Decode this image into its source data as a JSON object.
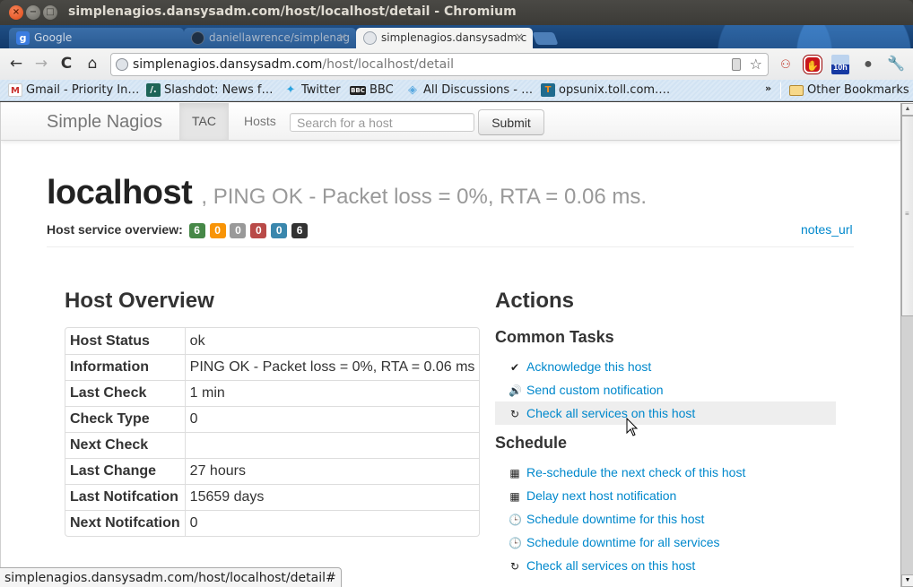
{
  "window": {
    "title": "simplenagios.dansysadm.com/host/localhost/detail - Chromium"
  },
  "tabs": [
    {
      "label": "Google",
      "icon": "google-g-icon",
      "active": false
    },
    {
      "label": "daniellawrence/simplenag",
      "icon": "github-icon",
      "active": false
    },
    {
      "label": "simplenagios.dansysadm.c",
      "icon": "globe-icon",
      "active": true
    }
  ],
  "toolbar": {
    "url_host": "simplenagios.dansysadm.com",
    "url_path": "/host/localhost/detail",
    "back_glyph": "←",
    "forward_glyph": "→",
    "reload_glyph": "C",
    "home_glyph": "🏠",
    "star_glyph": "☆",
    "extensions": [
      {
        "name": "graph-extension-icon",
        "glyph": "♙"
      },
      {
        "name": "adblock-icon",
        "glyph": "✋"
      },
      {
        "name": "timer-extension-icon",
        "glyph": "10h"
      },
      {
        "name": "droplet-icon",
        "glyph": "💧"
      },
      {
        "name": "wrench-icon",
        "glyph": "🔧"
      }
    ]
  },
  "bookmarks": [
    {
      "label": "Gmail - Priority In…",
      "icon_glyph": "M"
    },
    {
      "label": "Slashdot: News f…",
      "icon_glyph": "/."
    },
    {
      "label": "Twitter",
      "icon_glyph": "🐦"
    },
    {
      "label": "BBC",
      "icon_glyph": "BBC"
    },
    {
      "label": "All Discussions - …",
      "icon_glyph": "◈"
    },
    {
      "label": "opsunix.toll.com.…",
      "icon_glyph": "T"
    },
    {
      "label": "Other Bookmarks",
      "icon_glyph": ""
    }
  ],
  "bookmarks_more": "»",
  "nav": {
    "brand": "Simple Nagios",
    "items": [
      {
        "label": "TAC",
        "active": true
      },
      {
        "label": "Hosts",
        "active": false
      }
    ],
    "search_placeholder": "Search for a host",
    "submit_label": "Submit"
  },
  "host": {
    "name": "localhost",
    "status_text": ", PING OK - Packet loss = 0%, RTA = 0.06 ms.",
    "overview_label": "Host service overview:",
    "badges": [
      {
        "value": "6",
        "meaning": "ok",
        "color": "#468847"
      },
      {
        "value": "0",
        "meaning": "warning",
        "color": "#f89406"
      },
      {
        "value": "0",
        "meaning": "unknown",
        "color": "#999999"
      },
      {
        "value": "0",
        "meaning": "critical",
        "color": "#b94a48"
      },
      {
        "value": "0",
        "meaning": "info",
        "color": "#3a87ad"
      },
      {
        "value": "6",
        "meaning": "total",
        "color": "#333333"
      }
    ],
    "notes_url_label": "notes_url"
  },
  "host_overview": {
    "title": "Host Overview",
    "rows": [
      {
        "label": "Host Status",
        "value": "ok"
      },
      {
        "label": "Information",
        "value": "PING OK - Packet loss = 0%, RTA = 0.06 ms"
      },
      {
        "label": "Last Check",
        "value": "1 min"
      },
      {
        "label": "Check Type",
        "value": "0"
      },
      {
        "label": "Next Check",
        "value": ""
      },
      {
        "label": "Last Change",
        "value": "27 hours"
      },
      {
        "label": "Last Notifcation",
        "value": "15659 days"
      },
      {
        "label": "Next Notifcation",
        "value": "0"
      }
    ]
  },
  "actions": {
    "title": "Actions",
    "common_title": "Common Tasks",
    "common": [
      {
        "label": "Acknowledge this host",
        "icon": "checkmark-icon",
        "glyph": "✔"
      },
      {
        "label": "Send custom notification",
        "icon": "volume-icon",
        "glyph": "🔊"
      },
      {
        "label": "Check all services on this host",
        "icon": "refresh-icon",
        "glyph": "↻",
        "hover": true
      }
    ],
    "schedule_title": "Schedule",
    "schedule": [
      {
        "label": "Re-schedule the next check of this host",
        "icon": "calendar-icon",
        "glyph": "▦"
      },
      {
        "label": "Delay next host notification",
        "icon": "calendar-icon",
        "glyph": "▦"
      },
      {
        "label": "Schedule downtime for this host",
        "icon": "clock-icon",
        "glyph": "🕒"
      },
      {
        "label": "Schedule downtime for all services",
        "icon": "clock-icon",
        "glyph": "🕒"
      },
      {
        "label": "Check all services on this host",
        "icon": "refresh-icon",
        "glyph": "↻"
      }
    ]
  },
  "status_bar": {
    "text": "simplenagios.dansysadm.com/host/localhost/detail#"
  }
}
